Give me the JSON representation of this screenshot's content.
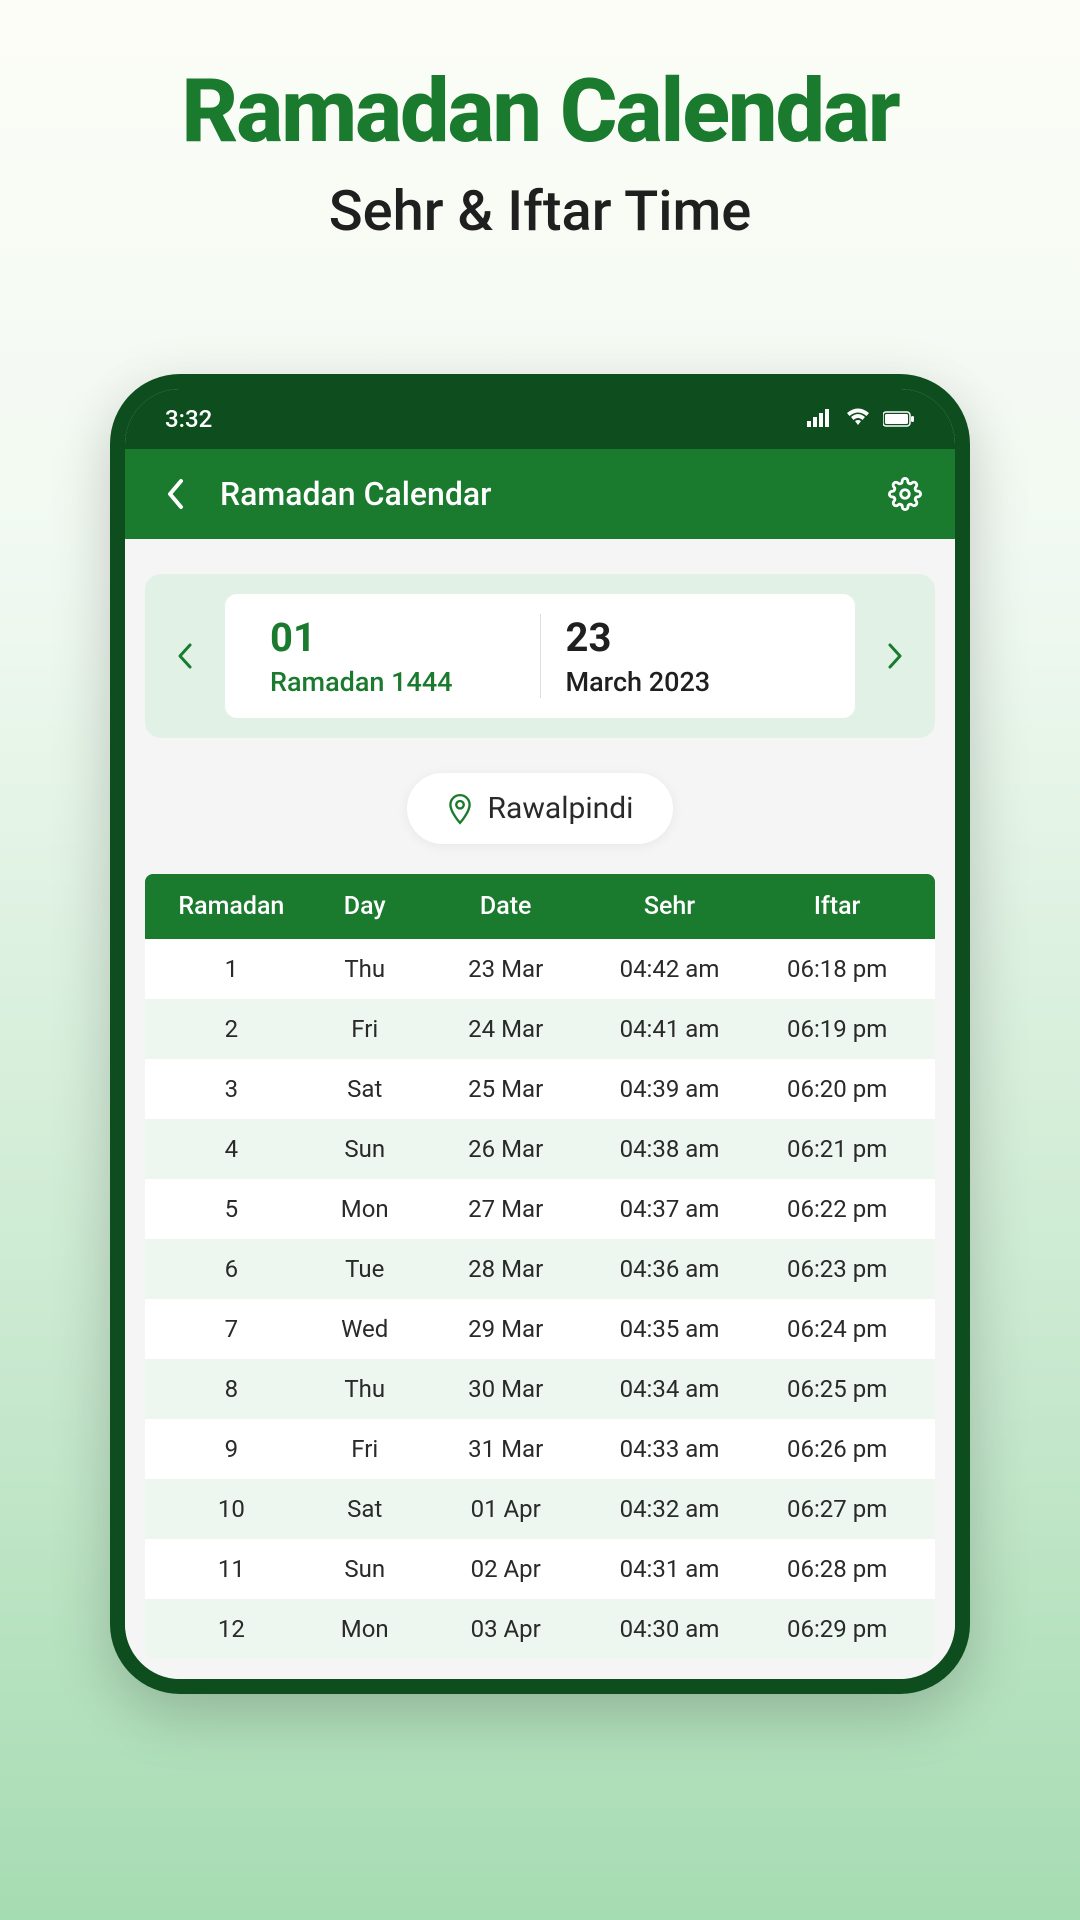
{
  "marketing": {
    "title": "Ramadan Calendar",
    "subtitle": "Sehr & Iftar Time"
  },
  "statusBar": {
    "time": "3:32"
  },
  "header": {
    "title": "Ramadan Calendar"
  },
  "dateSelector": {
    "hijri": {
      "day": "01",
      "month": "Ramadan 1444"
    },
    "gregorian": {
      "day": "23",
      "month": "March 2023"
    }
  },
  "location": "Rawalpindi",
  "table": {
    "headers": {
      "ramadan": "Ramadan",
      "day": "Day",
      "date": "Date",
      "sehr": "Sehr",
      "iftar": "Iftar"
    },
    "rows": [
      {
        "ramadan": "1",
        "day": "Thu",
        "date": "23 Mar",
        "sehr": "04:42 am",
        "iftar": "06:18 pm"
      },
      {
        "ramadan": "2",
        "day": "Fri",
        "date": "24 Mar",
        "sehr": "04:41 am",
        "iftar": "06:19 pm"
      },
      {
        "ramadan": "3",
        "day": "Sat",
        "date": "25 Mar",
        "sehr": "04:39 am",
        "iftar": "06:20 pm"
      },
      {
        "ramadan": "4",
        "day": "Sun",
        "date": "26 Mar",
        "sehr": "04:38 am",
        "iftar": "06:21 pm"
      },
      {
        "ramadan": "5",
        "day": "Mon",
        "date": "27 Mar",
        "sehr": "04:37 am",
        "iftar": "06:22 pm"
      },
      {
        "ramadan": "6",
        "day": "Tue",
        "date": "28 Mar",
        "sehr": "04:36 am",
        "iftar": "06:23 pm"
      },
      {
        "ramadan": "7",
        "day": "Wed",
        "date": "29 Mar",
        "sehr": "04:35 am",
        "iftar": "06:24 pm"
      },
      {
        "ramadan": "8",
        "day": "Thu",
        "date": "30 Mar",
        "sehr": "04:34 am",
        "iftar": "06:25 pm"
      },
      {
        "ramadan": "9",
        "day": "Fri",
        "date": "31 Mar",
        "sehr": "04:33 am",
        "iftar": "06:26 pm"
      },
      {
        "ramadan": "10",
        "day": "Sat",
        "date": "01 Apr",
        "sehr": "04:32 am",
        "iftar": "06:27 pm"
      },
      {
        "ramadan": "11",
        "day": "Sun",
        "date": "02 Apr",
        "sehr": "04:31 am",
        "iftar": "06:28 pm"
      },
      {
        "ramadan": "12",
        "day": "Mon",
        "date": "03 Apr",
        "sehr": "04:30 am",
        "iftar": "06:29 pm"
      }
    ]
  }
}
